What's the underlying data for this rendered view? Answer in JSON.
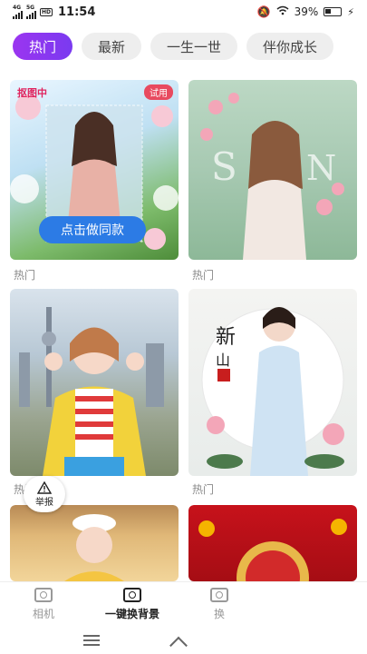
{
  "status": {
    "sig1": "4G",
    "sig2": "5G",
    "hd": "HD",
    "time": "11:54",
    "battery": "39%"
  },
  "tabs": [
    {
      "label": "热门",
      "active": true
    },
    {
      "label": "最新",
      "active": false
    },
    {
      "label": "一生一世",
      "active": false
    },
    {
      "label": "伴你成长",
      "active": false
    }
  ],
  "cards": [
    {
      "label": "热门",
      "badge_left": "抠图中",
      "badge_trial": "试用",
      "button": "点击做同款"
    },
    {
      "label": "热门"
    },
    {
      "label": "热门"
    },
    {
      "label": "热门"
    },
    {
      "label": ""
    },
    {
      "label": ""
    }
  ],
  "report": {
    "label": "举报"
  },
  "bottom_nav": [
    {
      "label": "相机",
      "active": false
    },
    {
      "label": "一键换背景",
      "active": true
    },
    {
      "label": "换",
      "active": false
    }
  ],
  "colors": {
    "accent": "#8b3bf0",
    "button_blue": "#2c7be5",
    "trial_red": "#e84a5f"
  }
}
